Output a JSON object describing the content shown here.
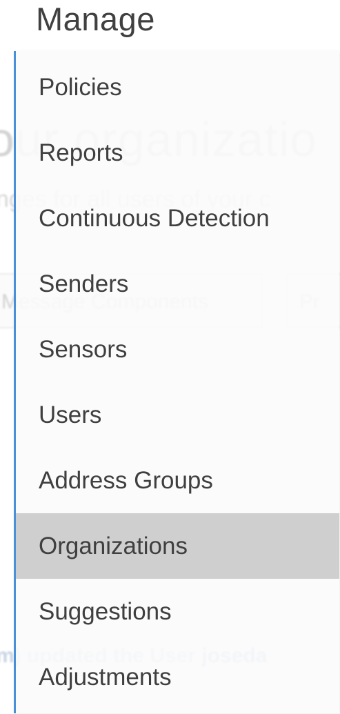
{
  "menu": {
    "title": "Manage",
    "accent_color": "#4a90d9",
    "selected_bg": "#cfcfcf",
    "items": [
      {
        "label": "Policies"
      },
      {
        "label": "Reports"
      },
      {
        "label": "Continuous Detection"
      },
      {
        "label": "Senders"
      },
      {
        "label": "Sensors"
      },
      {
        "label": "Users"
      },
      {
        "label": "Address Groups"
      },
      {
        "label": "Organizations",
        "selected": true
      },
      {
        "label": "Suggestions"
      },
      {
        "label": "Adjustments"
      }
    ]
  },
  "background": {
    "heading_fragment": "our organizatio",
    "subtext_fragment": "nges for all users of your c",
    "button_message_components": "Message Components",
    "button_fragment": "Pr",
    "activity_prefix": "m) updated the User",
    "activity_link": "joseda"
  }
}
